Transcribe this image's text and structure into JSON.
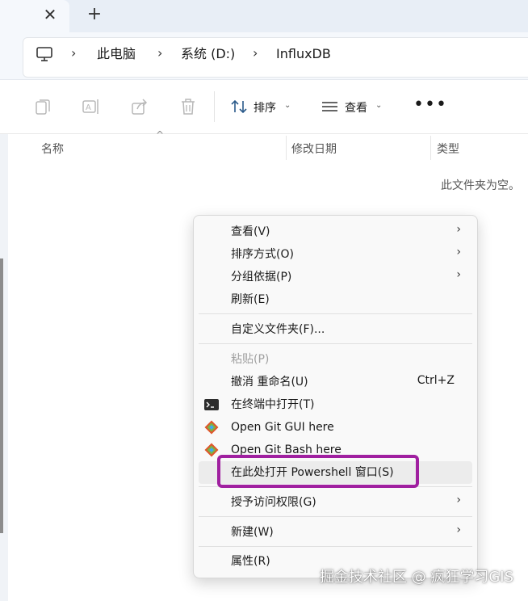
{
  "tabs": {
    "new_tab_symbol": "+",
    "close_symbol": "✕"
  },
  "breadcrumb": {
    "items": [
      "此电脑",
      "系统 (D:)",
      "InfluxDB"
    ],
    "separator": "›"
  },
  "toolbar": {
    "sort_label": "排序",
    "view_label": "查看",
    "more_label": "•••"
  },
  "columns": {
    "name": "名称",
    "modified": "修改日期",
    "type": "类型"
  },
  "empty_message": "此文件夹为空。",
  "context_menu": {
    "view": "查看(V)",
    "sort_by": "排序方式(O)",
    "group_by": "分组依据(P)",
    "refresh": "刷新(E)",
    "customize": "自定义文件夹(F)...",
    "paste": "粘贴(P)",
    "undo_rename": "撤消 重命名(U)",
    "undo_shortcut": "Ctrl+Z",
    "open_terminal": "在终端中打开(T)",
    "git_gui": "Open Git GUI here",
    "git_bash": "Open Git Bash here",
    "open_powershell": "在此处打开 Powershell 窗口(S)",
    "grant_access": "授予访问权限(G)",
    "new": "新建(W)",
    "properties": "属性(R)"
  },
  "watermark": "掘金技术社区 @ 疯狂学习GIS",
  "colors": {
    "highlight": "#a020a0",
    "accent": "#0067c0"
  }
}
